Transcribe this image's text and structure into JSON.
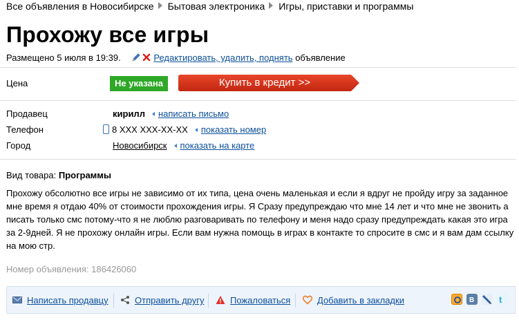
{
  "breadcrumb": [
    "Все объявления в Новосибирске",
    "Бытовая электроника",
    "Игры, приставки и программы"
  ],
  "title": "Прохожу все игры",
  "posted": {
    "text": "Размещено 5 июля в 19:39.",
    "edit_link": "Редактировать, удалить, поднять",
    "suffix": "объявление"
  },
  "price": {
    "label": "Цена",
    "value": "Не указана",
    "credit_button": "Купить в кредит >>"
  },
  "seller": {
    "label": "Продавец",
    "name": "кирилл",
    "write_link": "написать письмо"
  },
  "phone": {
    "label": "Телефон",
    "number": "8 XXX XXX-XX-XX",
    "show_link": "показать номер"
  },
  "city": {
    "label": "Город",
    "name": "Новосибирск",
    "map_link": "показать на карте"
  },
  "item_type": {
    "label": "Вид товара:",
    "value": "Программы"
  },
  "description": "Прохожу обсолютно все игры не зависимо от их типа, цена очень маленькая и если я вдруг не пройду игру за заданное мне время я отдаю 40% от стоимости прохождения игры. Я Сразу предупреждаю что мне 14 лет и что мне не звонить а писать только смс потому-что я не люблю разговаривать по телефону и меня надо сразу предупреждать какая это игра за 2-9дней. Я не прохожу онлайн игры. Если вам нужна помощь в играх в контакте то спросите в смс и я вам дам ссылку на мою стр.",
  "ad_number": "Номер объявления: 186426060",
  "footer": {
    "write_seller": "Написать продавцу",
    "send_friend": "Отправить другу",
    "complain": "Пожаловаться",
    "bookmark": "Добавить в закладки"
  },
  "colors": {
    "link": "#0b4f9c",
    "price_badge": "#2ea826",
    "credit_button": "#d83017"
  },
  "icons": [
    "pencil-icon",
    "delete-x-icon",
    "phone-icon",
    "envelope-icon",
    "share-icon",
    "warning-icon",
    "heart-icon",
    "mailru-icon",
    "vkontakte-icon",
    "livejournal-icon",
    "twitter-icon"
  ]
}
